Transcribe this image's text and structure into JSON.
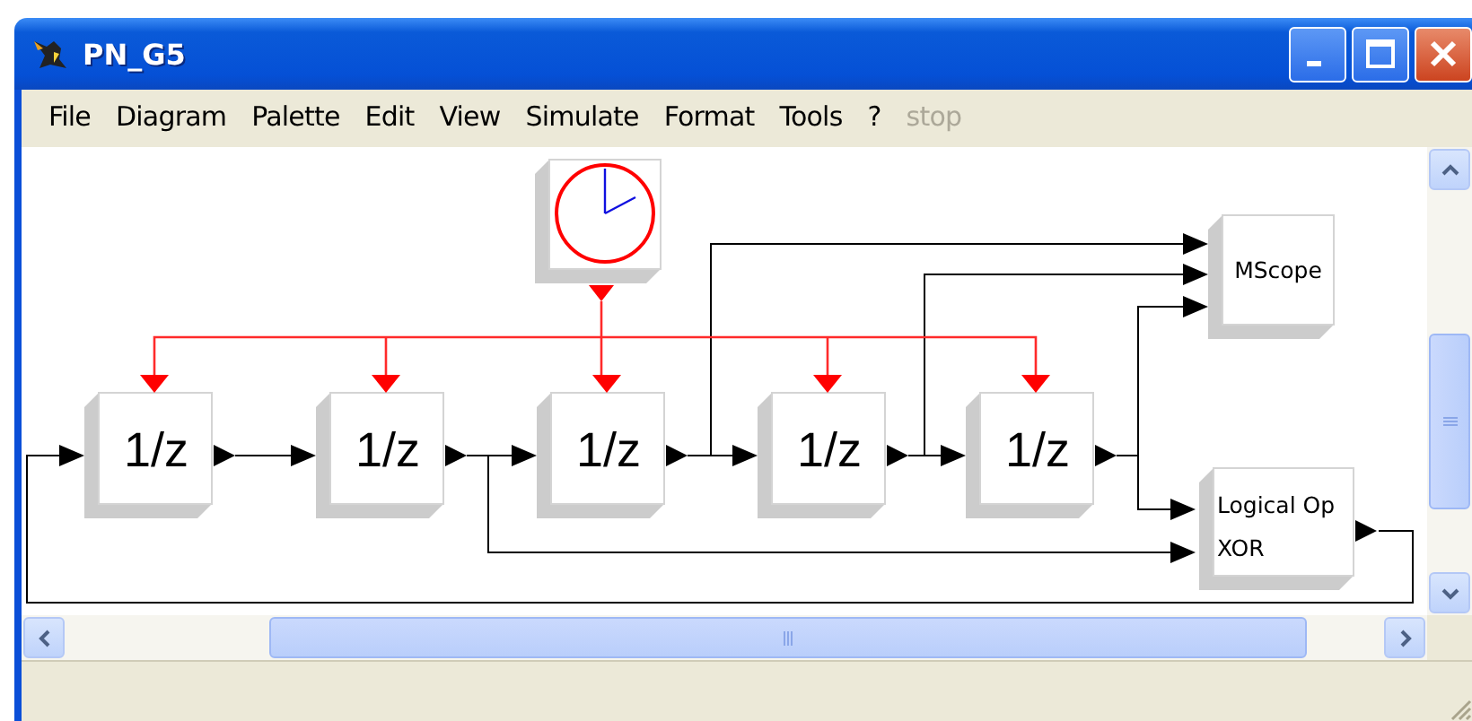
{
  "window": {
    "title": "PN_G5"
  },
  "menu": [
    {
      "label": "File",
      "disabled": false
    },
    {
      "label": "Diagram",
      "disabled": false
    },
    {
      "label": "Palette",
      "disabled": false
    },
    {
      "label": "Edit",
      "disabled": false
    },
    {
      "label": "View",
      "disabled": false
    },
    {
      "label": "Simulate",
      "disabled": false
    },
    {
      "label": "Format",
      "disabled": false
    },
    {
      "label": "Tools",
      "disabled": false
    },
    {
      "label": "?",
      "disabled": false
    },
    {
      "label": "stop",
      "disabled": true
    }
  ],
  "blocks": [
    {
      "kind": "clock"
    },
    {
      "kind": "delay",
      "label": "1/z"
    },
    {
      "kind": "delay",
      "label": "1/z"
    },
    {
      "kind": "delay",
      "label": "1/z"
    },
    {
      "kind": "delay",
      "label": "1/z"
    },
    {
      "kind": "delay",
      "label": "1/z"
    },
    {
      "kind": "scope",
      "label": "MScope"
    },
    {
      "kind": "logic",
      "lines": [
        "Logical Op",
        "XOR"
      ]
    }
  ]
}
